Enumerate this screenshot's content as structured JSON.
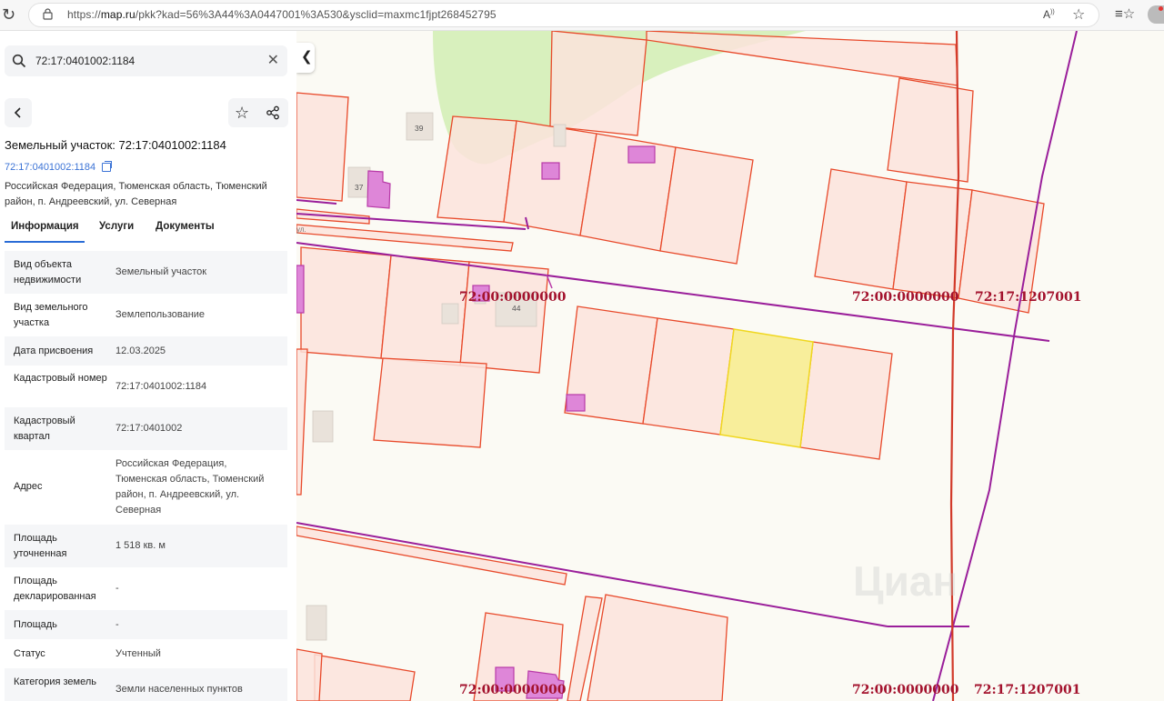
{
  "browser": {
    "url_prefix": "https://",
    "url_host": "map.ru",
    "url_rest": "/pkk?kad=56%3A44%3A0447001%3A530&ysclid=maxmc1fjpt268452795"
  },
  "search": {
    "value": "72:17:0401002:1184"
  },
  "panel": {
    "title": "Земельный участок: 72:17:0401002:1184",
    "cadastral_link": "72:17:0401002:1184",
    "address": "Российская Федерация, Тюменская область, Тюменский район, п. Андреевский, ул. Северная",
    "tabs": [
      {
        "label": "Информация",
        "active": true
      },
      {
        "label": "Услуги",
        "active": false
      },
      {
        "label": "Документы",
        "active": false
      }
    ],
    "rows": [
      {
        "key": "Вид объекта недвижимости",
        "value": "Земельный участок"
      },
      {
        "key": "Вид земельного участка",
        "value": "Землепользование"
      },
      {
        "key": "Дата присвоения",
        "value": "12.03.2025"
      },
      {
        "key": "Кадастровый номер",
        "value": "72:17:0401002:1184"
      },
      {
        "key": "Кадастровый квартал",
        "value": "72:17:0401002"
      },
      {
        "key": "Адрес",
        "value": "Российская Федерация, Тюменская область, Тюменский район, п. Андреевский, ул. Северная"
      },
      {
        "key": "Площадь уточненная",
        "value": "1 518 кв. м"
      },
      {
        "key": "Площадь декларированная",
        "value": "-"
      },
      {
        "key": "Площадь",
        "value": "-"
      },
      {
        "key": "Статус",
        "value": "Учтенный"
      },
      {
        "key": "Категория земель",
        "value": "Земли населенных пунктов"
      }
    ]
  },
  "map": {
    "labels": [
      "72:00:0000000",
      "72:00:0000000",
      "72:17:1207001",
      "72:00:0000000",
      "72:00:0000000",
      "72:17:1207001"
    ],
    "house_numbers": [
      "39",
      "37",
      "44"
    ],
    "street_fragment": "ул.",
    "watermark": "Циан",
    "colors": {
      "parcel_fill": "#fbe3dc",
      "parcel_stroke": "#e8492a",
      "selected_parcel": "#f8ee9b",
      "building": "#de86d8",
      "boundary": "#9a1e9a",
      "green_area": "#d8f0bd",
      "label_text": "#a3122d"
    }
  }
}
